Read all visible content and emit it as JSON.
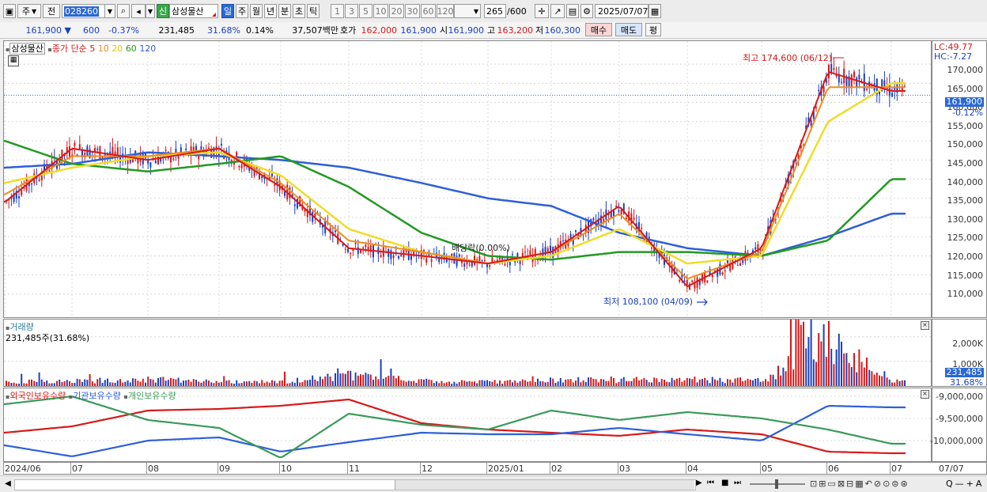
{
  "toolbar": {
    "period_main": "주",
    "prev_label": "전",
    "stock_code": "028260",
    "credit_badge": "신",
    "stock_name": "삼성물산",
    "period_tabs": [
      "일",
      "주",
      "월",
      "년",
      "분",
      "초",
      "틱"
    ],
    "interval_options": [
      "1",
      "3",
      "5",
      "10",
      "20",
      "30",
      "60",
      "120"
    ],
    "count_value": "265",
    "count_total": "/600",
    "date_value": "2025/07/07"
  },
  "quote": {
    "price": "161,900",
    "direction": "▼",
    "change": "600",
    "change_pct": "-0.37%",
    "volume": "231,485",
    "volume_ratio": "31.68%",
    "turnover": "0.14%",
    "trade_amount": "37,507백만",
    "bid_label": "호가",
    "bid_sell": "162,000",
    "bid_buy": "161,900",
    "open_label": "시",
    "open": "161,900",
    "high_label": "고",
    "high": "163,200",
    "low_label": "저",
    "low": "160,300",
    "buy_button": "매수",
    "sell_button": "매도",
    "eval_button": "평"
  },
  "price_pane": {
    "legend": {
      "name": "삼성물산",
      "type": "종가 단순",
      "ma5": "5",
      "ma10": "10",
      "ma20": "20",
      "ma60": "60",
      "ma120": "120"
    },
    "y_labels": [
      "170,000",
      "165,000",
      "160,000",
      "155,000",
      "150,000",
      "145,000",
      "140,000",
      "135,000",
      "130,000",
      "125,000",
      "120,000",
      "115,000",
      "110,000"
    ],
    "lc": "LC:49.77",
    "hc": "HC:-7.27",
    "last_price_tag": "161,900",
    "last_change_tag": "-0.12%",
    "annot_high": "최고 174,600 (06/12)",
    "annot_low": "최저 108,100 (04/09)",
    "annot_dividend": "배당락(0.00%)"
  },
  "volume_pane": {
    "title": "거래량",
    "value_text": "231,485주(31.68%)",
    "y_labels": [
      "2,000K",
      "1,000K"
    ],
    "last_tag": "231,485",
    "last_pct": "31.68%"
  },
  "holding_pane": {
    "legend": [
      "외국인보유수량",
      "기관보유수량",
      "개인보유수량"
    ],
    "y_labels": [
      "-9,000,000",
      "-9,500,000",
      "-10,000,000"
    ]
  },
  "x_axis": {
    "labels": [
      "2024/06",
      "07",
      "08",
      "09",
      "10",
      "11",
      "12",
      "2025/01",
      "02",
      "03",
      "04",
      "05",
      "06",
      "07"
    ],
    "right_label": "07/07"
  },
  "colors": {
    "up": "#d81818",
    "down": "#1a40c0",
    "ma5": "#d81818",
    "ma10": "#f08c1e",
    "ma20": "#f0dc28",
    "ma60": "#229922",
    "ma120": "#2d5fd8",
    "foreign": "#d81818",
    "institution": "#2d5fd8",
    "individual": "#3a9a5a"
  },
  "chart_data": {
    "type": "line",
    "title": "",
    "x": [
      "2024/06",
      "07",
      "08",
      "09",
      "10",
      "11",
      "12",
      "2025/01",
      "02",
      "03",
      "04",
      "05",
      "06",
      "07"
    ],
    "series": [
      {
        "name": "5",
        "values": [
          134000,
          148000,
          145000,
          148000,
          138000,
          122000,
          120000,
          118000,
          121000,
          133000,
          112000,
          122000,
          168000,
          163000
        ]
      },
      {
        "name": "10",
        "values": [
          136000,
          146000,
          146000,
          148000,
          139000,
          124000,
          121000,
          118000,
          121000,
          131000,
          114000,
          121000,
          164000,
          164000
        ]
      },
      {
        "name": "20",
        "values": [
          139000,
          143000,
          146000,
          147000,
          141000,
          127000,
          121000,
          118000,
          120000,
          127000,
          118000,
          120000,
          155000,
          165000
        ]
      },
      {
        "name": "60",
        "values": [
          150000,
          144000,
          142000,
          144000,
          146000,
          138000,
          126000,
          120000,
          119000,
          121000,
          121000,
          120000,
          124000,
          140000
        ]
      },
      {
        "name": "120",
        "values": [
          143000,
          144000,
          147000,
          146000,
          145000,
          143000,
          139000,
          135000,
          133000,
          126000,
          122000,
          120000,
          125000,
          131000
        ]
      }
    ],
    "volume_k": [
      200,
      240,
      320,
      180,
      200,
      520,
      230,
      220,
      280,
      300,
      320,
      260,
      2300,
      230
    ],
    "high": 174600,
    "low": 108100,
    "ylim": [
      104000,
      176000
    ]
  }
}
